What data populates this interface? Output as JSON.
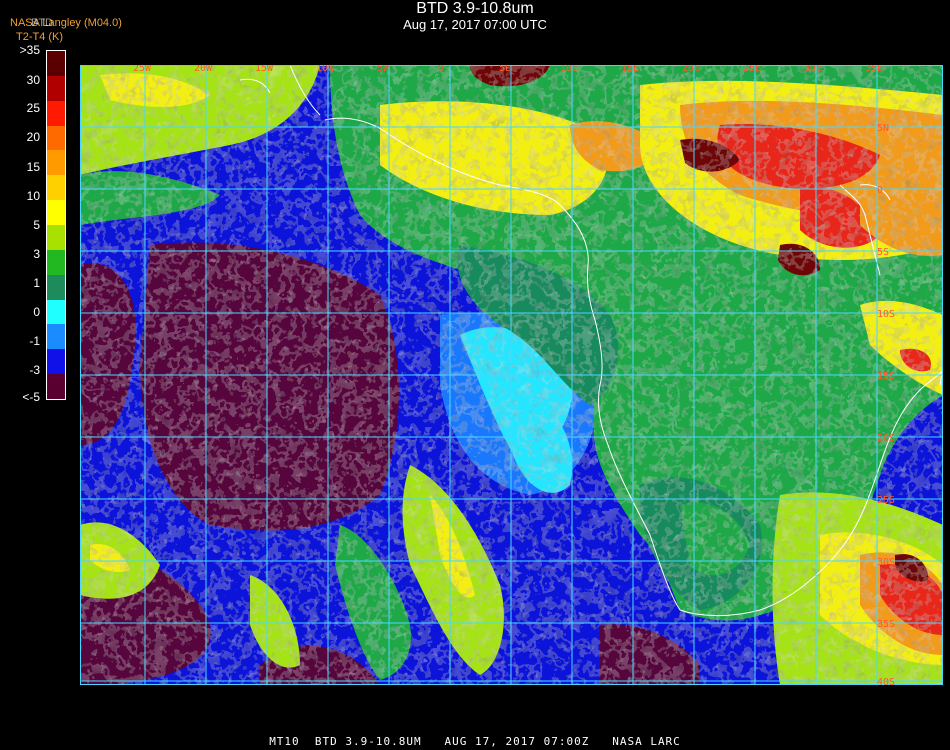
{
  "header": {
    "title": "BTD 3.9-10.8um",
    "subtitle": "Aug 17, 2017 07:00 UTC",
    "org_line1": "NASA Langley (M04.0)",
    "org_line2": "T2-T4 (K)",
    "org_overlap": "BTD"
  },
  "legend": {
    "labels": [
      ">35",
      "30",
      "25",
      "20",
      "15",
      "10",
      "5",
      "3",
      "1",
      "0",
      "-1",
      "-3",
      "<-5"
    ],
    "colors": [
      "#5a0000",
      "#b00000",
      "#ff1a00",
      "#ff6a00",
      "#ff9a00",
      "#ffd000",
      "#ffff00",
      "#a8e000",
      "#22b822",
      "#1e8c5a",
      "#20ffff",
      "#1a8cff",
      "#1010e8",
      "#5a0030"
    ]
  },
  "map": {
    "lon_labels": [
      "25W",
      "20W",
      "15W",
      "10W",
      "5W",
      "0",
      "5E",
      "10E",
      "15E",
      "20E",
      "25E",
      "30E",
      "35E"
    ],
    "lat_labels": [
      "5N",
      "0",
      "5S",
      "10S",
      "15S",
      "20S",
      "25S",
      "30S",
      "35S",
      "40S"
    ],
    "palette": {
      "sea": "#0d14d9",
      "sea_light": "#1a78ff",
      "cyan": "#26e5ff",
      "deep": "#56063c",
      "green": "#1ea848",
      "teal": "#178a5e",
      "lime": "#a6e316",
      "yellow": "#f3ef12",
      "orange": "#f29a1a",
      "red": "#e8261a",
      "dark_red": "#6e0608",
      "grid": "#48d8ff",
      "coast": "#ffffff"
    }
  },
  "footer": {
    "text": "MT10  BTD 3.9-10.8UM   AUG 17, 2017 07:00Z   NASA LARC"
  }
}
